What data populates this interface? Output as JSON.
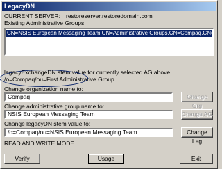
{
  "window": {
    "title": "LegacyDN"
  },
  "server": {
    "label": "CURRENT SERVER:",
    "value": "restoreserver.restoredomain.com"
  },
  "groups": {
    "label": "Existing Administrative Groups",
    "items": [
      "CN=NSIS European Messaging Team,CN=Administrative Groups,CN=Compaq,CN=Microsoft Exchange,CN"
    ]
  },
  "legacy_value": {
    "label": "legacyExchangeDN stem value for currently selected AG above",
    "value": "/o=Compaq/ou=First Administrative Group"
  },
  "org": {
    "label": "Change organization name to:",
    "value": "Compaq",
    "button": "Change Org"
  },
  "ag": {
    "label": "Change administrative group name to:",
    "value": "NSIS European Messaging Team",
    "button": "Change AG"
  },
  "leg": {
    "label": "Change legacyDN stem value to:",
    "value": "/o=Compaq/ou=NSIS European Messaging Team",
    "button": "Change Leg"
  },
  "mode": {
    "label": "READ AND WRITE MODE"
  },
  "footer": {
    "verify": "Verify",
    "usage": "Usage",
    "exit": "Exit"
  }
}
